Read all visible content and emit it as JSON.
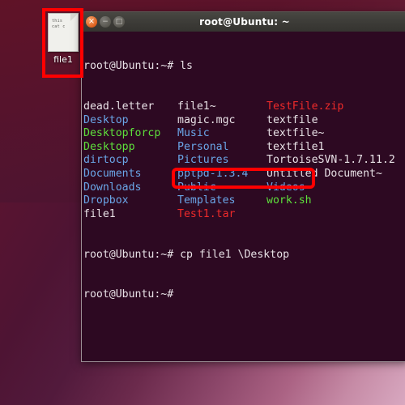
{
  "desktop": {
    "icon": {
      "name": "file1",
      "thumb_line1": "this",
      "thumb_line2": "cat c"
    }
  },
  "window": {
    "title": "root@Ubuntu: ~",
    "controls": {
      "close": "×",
      "minimize": "−",
      "maximize": "□"
    }
  },
  "terminal": {
    "prompt": "root@Ubuntu:~#",
    "line_ls": {
      "prompt": "root@Ubuntu:~#",
      "command": " ls"
    },
    "listing": [
      {
        "c1": "dead.letter",
        "c1color": "c-white",
        "c2": "file1~",
        "c2color": "c-white",
        "c3": "TestFile.zip",
        "c3color": "c-red"
      },
      {
        "c1": "Desktop",
        "c1color": "c-blue",
        "c2": "magic.mgc",
        "c2color": "c-white",
        "c3": "textfile",
        "c3color": "c-white"
      },
      {
        "c1": "Desktopforcp",
        "c1color": "c-green",
        "c2": "Music",
        "c2color": "c-blue",
        "c3": "textfile~",
        "c3color": "c-white"
      },
      {
        "c1": "Desktopp",
        "c1color": "c-green",
        "c2": "Personal",
        "c2color": "c-blue",
        "c3": "textfile1",
        "c3color": "c-white"
      },
      {
        "c1": "dirtocp",
        "c1color": "c-blue",
        "c2": "Pictures",
        "c2color": "c-blue",
        "c3": "TortoiseSVN-1.7.11.2",
        "c3color": "c-white"
      },
      {
        "c1": "Documents",
        "c1color": "c-blue",
        "c2": "pptpd-1.3.4",
        "c2color": "c-blue",
        "c3": "Untitled Document~",
        "c3color": "c-white"
      },
      {
        "c1": "Downloads",
        "c1color": "c-blue",
        "c2": "Public",
        "c2color": "c-blue",
        "c3": "Videos",
        "c3color": "c-blue"
      },
      {
        "c1": "Dropbox",
        "c1color": "c-blue",
        "c2": "Templates",
        "c2color": "c-blue",
        "c3": "work.sh",
        "c3color": "c-green"
      },
      {
        "c1": "file1",
        "c1color": "c-white",
        "c2": "Test1.tar",
        "c2color": "c-red",
        "c3": "",
        "c3color": "c-white"
      }
    ],
    "line_cp": {
      "prompt": "root@Ubuntu:~#",
      "command": " cp file1 \\Desktop"
    },
    "line_last": {
      "prompt": "root@Ubuntu:~#",
      "command": ""
    }
  },
  "annotations": {
    "icon_highlight": "file1-desktop-icon-highlight",
    "command_highlight": "cp-command-highlight"
  }
}
